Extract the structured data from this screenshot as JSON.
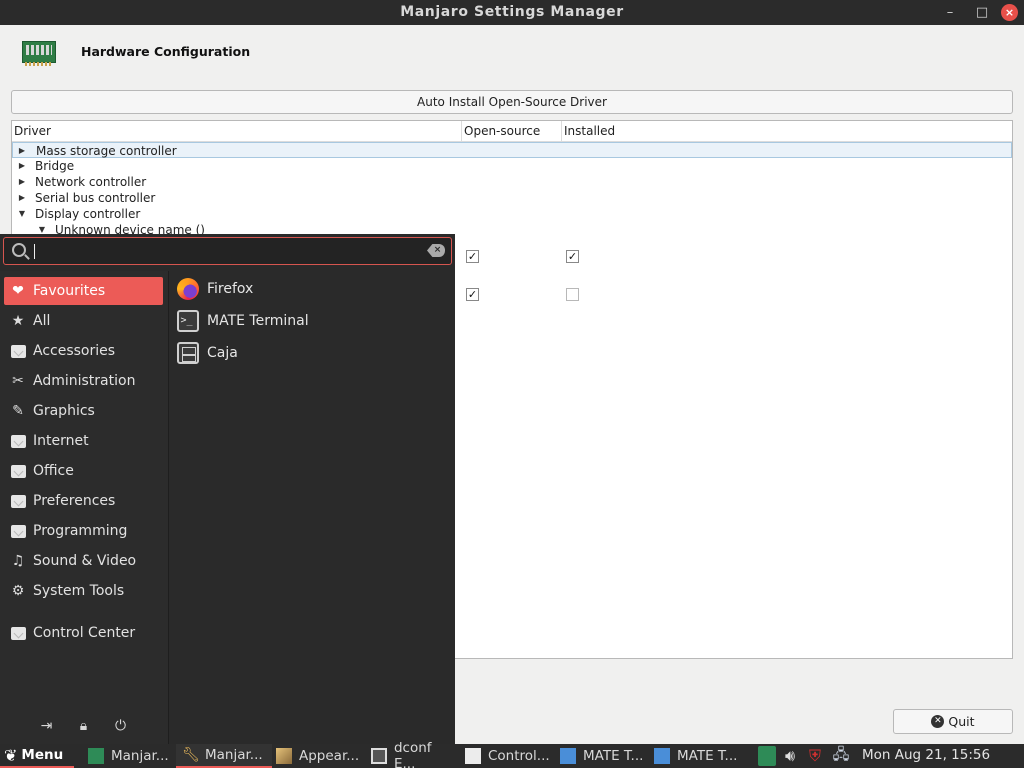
{
  "window": {
    "title": "Manjaro Settings Manager",
    "minimize": "–",
    "maximize": "□",
    "close": "×"
  },
  "header": {
    "title": "Hardware Configuration"
  },
  "auto_install_label": "Auto Install Open-Source Driver",
  "table": {
    "columns": [
      "Driver",
      "Open-source",
      "Installed"
    ],
    "rows": [
      {
        "label": "Mass storage controller"
      },
      {
        "label": "Bridge"
      },
      {
        "label": "Network controller"
      },
      {
        "label": "Serial bus controller"
      },
      {
        "label": "Display controller"
      },
      {
        "label": "Unknown device name ()"
      }
    ],
    "drivers": [
      {
        "open_source": true,
        "installed": true
      },
      {
        "open_source": true,
        "installed": false
      }
    ]
  },
  "quit_label": "Quit",
  "menu": {
    "search": {
      "value": "",
      "placeholder": ""
    },
    "categories": [
      {
        "label": "Favourites",
        "icon": "heart-icon"
      },
      {
        "label": "All",
        "icon": "star-icon"
      },
      {
        "label": "Accessories",
        "icon": "folder-icon"
      },
      {
        "label": "Administration",
        "icon": "tools-icon"
      },
      {
        "label": "Graphics",
        "icon": "palette-icon"
      },
      {
        "label": "Internet",
        "icon": "folder-icon"
      },
      {
        "label": "Office",
        "icon": "folder-icon"
      },
      {
        "label": "Preferences",
        "icon": "folder-icon"
      },
      {
        "label": "Programming",
        "icon": "folder-icon"
      },
      {
        "label": "Sound & Video",
        "icon": "media-icon"
      },
      {
        "label": "System Tools",
        "icon": "gear-icon"
      },
      {
        "label": "Control Center",
        "icon": "folder-icon"
      }
    ],
    "apps": [
      {
        "label": "Firefox",
        "icon": "firefox-icon"
      },
      {
        "label": "MATE Terminal",
        "icon": "terminal-icon"
      },
      {
        "label": "Caja",
        "icon": "file-manager-icon"
      }
    ]
  },
  "taskbar": {
    "menu_label": "Menu",
    "tasks": [
      {
        "label": "Manjar...",
        "icon": "manjaro-icon"
      },
      {
        "label": "Manjar...",
        "icon": "wrench-icon"
      },
      {
        "label": "Appear...",
        "icon": "appearance-icon"
      },
      {
        "label": "dconf E...",
        "icon": "dconf-icon"
      },
      {
        "label": "Control...",
        "icon": "control-center-icon"
      },
      {
        "label": "MATE T...",
        "icon": "terminal-icon"
      },
      {
        "label": "MATE T...",
        "icon": "terminal-icon"
      }
    ],
    "clock": "Mon Aug 21, 15:56"
  },
  "colors": {
    "accent": "#ec5b57",
    "titlebar": "#2b2b2b",
    "menu_bg": "#2a2a2a"
  }
}
